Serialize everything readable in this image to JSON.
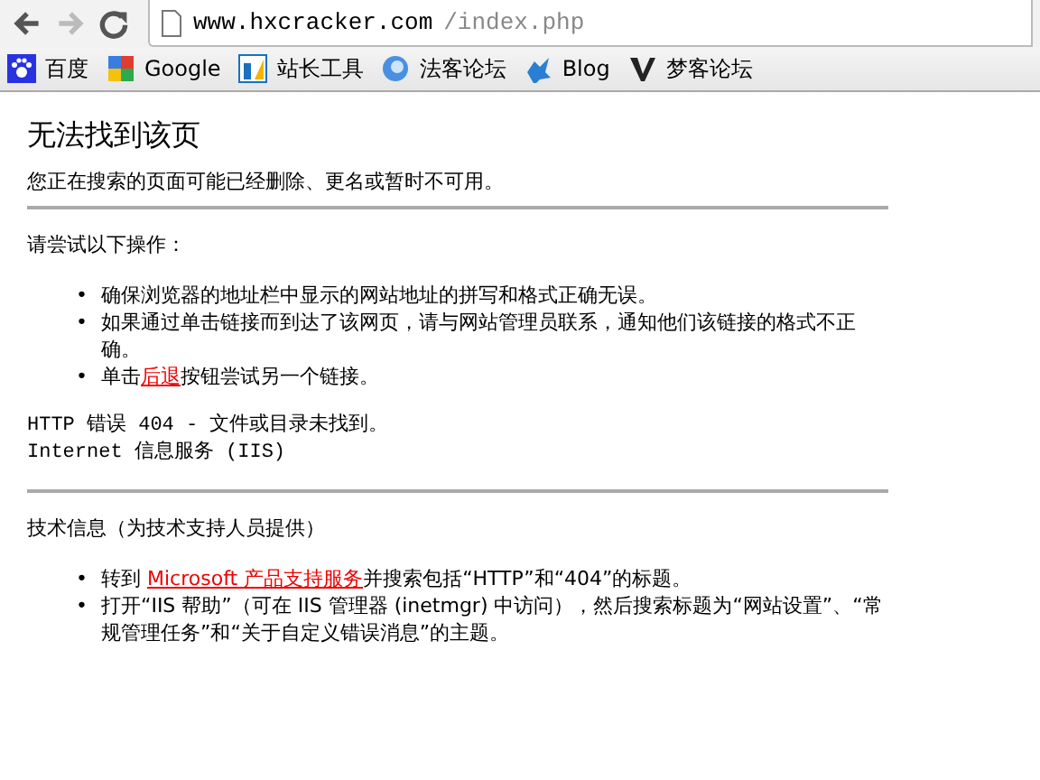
{
  "toolbar": {
    "url_host": "www.hxcracker.com",
    "url_path": "/index.php",
    "forward_disabled": true
  },
  "bookmarks": [
    {
      "label": "百度",
      "kind": "paw"
    },
    {
      "label": "Google",
      "kind": "blocks"
    },
    {
      "label": "站长工具",
      "kind": "chart"
    },
    {
      "label": "法客论坛",
      "kind": "globe"
    },
    {
      "label": "Blog",
      "kind": "splash"
    },
    {
      "label": "梦客论坛",
      "kind": "v"
    }
  ],
  "page": {
    "title": "无法找到该页",
    "subtitle": "您正在搜索的页面可能已经删除、更名或暂时不可用。",
    "try_heading": "请尝试以下操作：",
    "try_items": [
      {
        "marker": "•",
        "parts": [
          {
            "kind": "text",
            "text": "确保浏览器的地址栏中显示的网站地址的拼写和格式正确无误。"
          }
        ]
      },
      {
        "marker": "•",
        "parts": [
          {
            "kind": "text",
            "text": "如果通过单击链接而到达了该网页，请与网站管理员联系，通知他们该链接的格式不正确。"
          }
        ]
      },
      {
        "marker": "•",
        "parts": [
          {
            "kind": "text",
            "text": "单击"
          },
          {
            "kind": "link",
            "text": "后退"
          },
          {
            "kind": "text",
            "text": "按钮尝试另一个链接。"
          }
        ]
      }
    ],
    "error_lines": [
      "HTTP 错误 404 - 文件或目录未找到。",
      "Internet 信息服务 (IIS)"
    ],
    "tech_heading": "技术信息（为技术支持人员提供）",
    "tech_items": [
      {
        "marker": "•",
        "parts": [
          {
            "kind": "text",
            "text": "转到 "
          },
          {
            "kind": "link",
            "text": "Microsoft 产品支持服务"
          },
          {
            "kind": "text",
            "text": "并搜索包括“HTTP”和“404”的标题。"
          }
        ]
      },
      {
        "marker": "•",
        "parts": [
          {
            "kind": "text",
            "text": "打开“IIS 帮助”（可在 IIS 管理器 (inetmgr) 中访问），然后搜索标题为“网站设置”、“常规管理任务”和“关于自定义错误消息”的主题。"
          }
        ]
      }
    ]
  }
}
